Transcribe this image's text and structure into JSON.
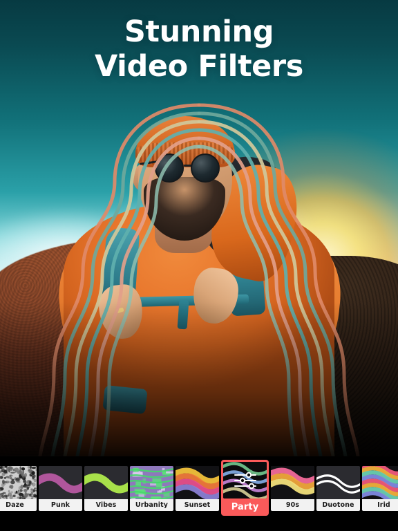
{
  "title": {
    "line1": "Stunning",
    "line2": "Video Filters"
  },
  "colors": {
    "selected_accent": "#fa5a5a",
    "label_bg": "#f2f2f2",
    "label_text": "#1b1b1b",
    "strip_bg": "#000000",
    "title_text": "#ffffff",
    "sky_top": "#073a42",
    "sky_mid": "#2aa0a8",
    "sunset_glow": "#ffe278",
    "jacket_orange": "#e3701f",
    "backpack_teal": "#2f8190"
  },
  "hero": {
    "subject": "bearded man in orange jacket with teal backpack",
    "outline_colors": [
      "#e08a68",
      "#7fb3a8",
      "#cfc79a",
      "#5fa8a8",
      "#e2a08a"
    ]
  },
  "filter_strip": {
    "selected": "Party",
    "tiles": [
      {
        "label": "Daze",
        "style": "noise",
        "selected": false,
        "clipped": "left"
      },
      {
        "label": "Punk",
        "style": "wave",
        "selected": false,
        "colors": [
          "#b0569c"
        ]
      },
      {
        "label": "Vibes",
        "style": "wave",
        "selected": false,
        "colors": [
          "#a8e04a"
        ]
      },
      {
        "label": "Urbanity",
        "style": "glitch",
        "selected": false,
        "colors": [
          "#5ce07a",
          "#9a7fc4"
        ]
      },
      {
        "label": "Sunset",
        "style": "stack",
        "selected": false,
        "colors": [
          "#f2c23a",
          "#f07a3a",
          "#e8508c",
          "#8a7fd4"
        ]
      },
      {
        "label": "Party",
        "style": "party",
        "selected": true,
        "colors": [
          "#6fc08a",
          "#7fa8e0",
          "#c080d0",
          "#cfc790"
        ],
        "icon": "sliders-icon"
      },
      {
        "label": "90s",
        "style": "stack",
        "selected": false,
        "colors": [
          "#f26a9a",
          "#f0a63a",
          "#f2e07a"
        ]
      },
      {
        "label": "Duotone",
        "style": "wave",
        "selected": false,
        "colors": [
          "#ffffff"
        ]
      },
      {
        "label": "Irid",
        "style": "irid",
        "selected": false,
        "colors": [
          "#f05a7a",
          "#f2b03a",
          "#6ad0b0",
          "#7f8ae0"
        ],
        "clipped": "right"
      }
    ]
  }
}
